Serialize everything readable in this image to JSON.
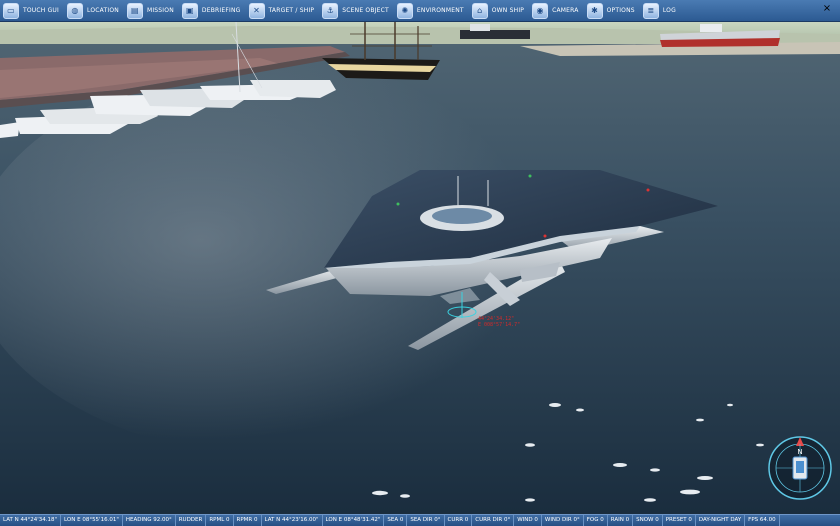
{
  "toolbar": {
    "items": [
      {
        "label": "TOUCH GUI",
        "icon": "monitor-icon"
      },
      {
        "label": "LOCATION",
        "icon": "globe-icon"
      },
      {
        "label": "MISSION",
        "icon": "document-icon"
      },
      {
        "label": "DEBRIEFING",
        "icon": "screen-icon"
      },
      {
        "label": "TARGET / SHIP",
        "icon": "target-icon"
      },
      {
        "label": "SCENE OBJECT",
        "icon": "anchor-icon"
      },
      {
        "label": "ENVIRONMENT",
        "icon": "sun-icon"
      },
      {
        "label": "OWN SHIP",
        "icon": "house-icon"
      },
      {
        "label": "CAMERA",
        "icon": "camera-icon"
      },
      {
        "label": "OPTIONS",
        "icon": "gear-icon"
      },
      {
        "label": "LOG",
        "icon": "log-icon"
      }
    ],
    "close_label": "×"
  },
  "overlay": {
    "coord_line1": "44°24'34.12\"",
    "coord_line2": "E 008°57'14.7\""
  },
  "compass": {
    "north_label": "N"
  },
  "statusbar": {
    "fields": [
      "LAT N 44°24'34.18\"",
      "LON E 08°55'16.01\"",
      "HEADING  92.00°",
      "RUDDER",
      "RPML  0",
      "RPMR  0",
      "LAT N 44°23'16.00\"",
      "LON E 08°48'31.42\"",
      "SEA 0",
      "SEA DIR  0°",
      "CURR 0",
      "CURR DIR  0°",
      "WIND 0",
      "WIND DIR  0°",
      "FOG 0",
      "RAIN 0",
      "SNOW 0",
      "PRESET 0",
      "DAY-NIGHT DAY",
      "FPS 64.00"
    ]
  },
  "colors": {
    "toolbar": "#3a6aa3",
    "sea": "#22384d",
    "overlay_text": "#d32a2a"
  }
}
